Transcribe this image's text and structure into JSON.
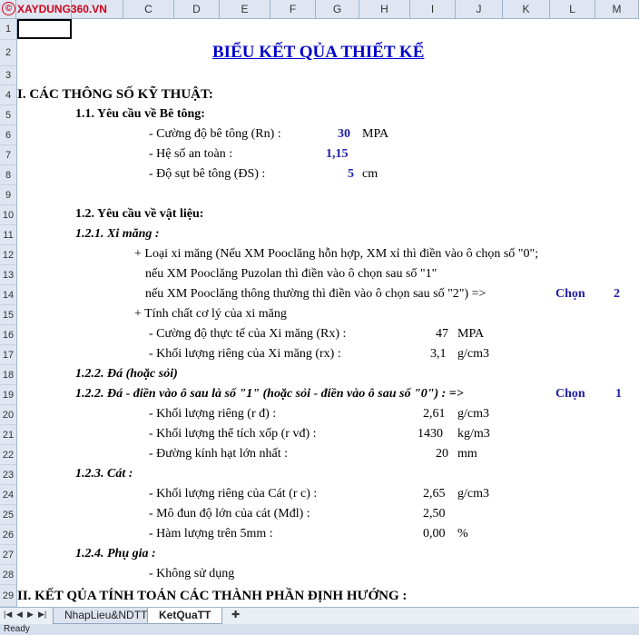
{
  "logo": {
    "text": "XAYDUNG360.VN",
    "mark": "©"
  },
  "columns": [
    "C",
    "D",
    "E",
    "F",
    "G",
    "H",
    "I",
    "J",
    "K",
    "L",
    "M"
  ],
  "row_numbers": [
    "1",
    "2",
    "3",
    "4",
    "5",
    "6",
    "7",
    "8",
    "9",
    "10",
    "11",
    "12",
    "13",
    "14",
    "15",
    "16",
    "17",
    "18",
    "19",
    "20",
    "21",
    "22",
    "23",
    "24",
    "25",
    "26",
    "27",
    "28",
    "29"
  ],
  "sheet": {
    "title": "BIỂU KẾT QỦA THIẾT KẾ",
    "sec1": "I. CÁC THÔNG SỐ KỸ THUẬT:",
    "s11": "1.1. Yêu cầu về Bê tông:",
    "rn_label": "- Cường độ bê tông (Rn) :",
    "rn_value": "30",
    "rn_unit": "MPA",
    "hs_label": "- Hệ số an toàn :",
    "hs_value": "1,15",
    "ds_label": "- Độ sụt bê tông (ĐS) :",
    "ds_value": "5",
    "ds_unit": "cm",
    "s12": "1.2. Yêu cầu về vật liệu:",
    "s121": "1.2.1. Xi măng :",
    "xm_line1": "+ Loại xi măng (Nếu XM Pooclăng hỗn hợp, XM xỉ thì điền vào ô chọn số \"0\";",
    "xm_line2": "nếu XM Pooclăng Puzolan thì điền vào ô chọn sau số \"1\"",
    "xm_line3": "nếu XM Pooclăng thông thường thì điền vào ô chọn sau số \"2\") =>",
    "xm_chon": "Chọn",
    "xm_chon_value": "2",
    "xm_tinhchat": "+ Tính chất cơ lý của xi măng",
    "rx_label": "- Cường độ thực tế của Xi măng (Rx) :",
    "rx_value": "47",
    "rx_unit": "MPA",
    "gx_label": "- Khối lượng riêng của Xi măng (rx) :",
    "gx_value": "3,1",
    "gx_unit": "g/cm3",
    "s122a": "1.2.2. Đá (hoặc sỏi)",
    "s122b": "1.2.2. Đá - điền vào ô sau là số \"1\" (hoặc sỏi - điền vào ô sau số \"0\") : =>",
    "da_chon": "Chọn",
    "da_chon_value": "1",
    "rd_label": "- Khối lượng riêng (r đ) :",
    "rd_value": "2,61",
    "rd_unit": "g/cm3",
    "rvd_label": "- Khối lượng thể tích xốp (r vđ) :",
    "rvd_value": "1430",
    "rvd_unit": "kg/m3",
    "dmax_label": "- Đường kính hạt lớn nhất :",
    "dmax_value": "20",
    "dmax_unit": "mm",
    "s123": "1.2.3. Cát :",
    "rc_label": "- Khối lượng riêng của Cát (r c) :",
    "rc_value": "2,65",
    "rc_unit": "g/cm3",
    "mdl_label": "- Mô đun độ lớn của cát (Mđl) :",
    "mdl_value": "2,50",
    "hl_label": "- Hàm lượng trên 5mm :",
    "hl_value": "0,00",
    "hl_unit": "%",
    "s124": "1.2.4. Phụ gia :",
    "pg_label": "- Không sử dụng",
    "sec2": "II. KẾT QỦA TÍNH TOÁN CÁC THÀNH PHẦN ĐỊNH HƯỚNG :"
  },
  "tabs": [
    "NhapLieu&NDTT",
    "KetQuaTT"
  ],
  "nav_icons": [
    "first-sheet-icon",
    "prev-sheet-icon",
    "next-sheet-icon",
    "last-sheet-icon"
  ],
  "new_sheet_icon": "new-sheet-icon",
  "status": "Ready"
}
